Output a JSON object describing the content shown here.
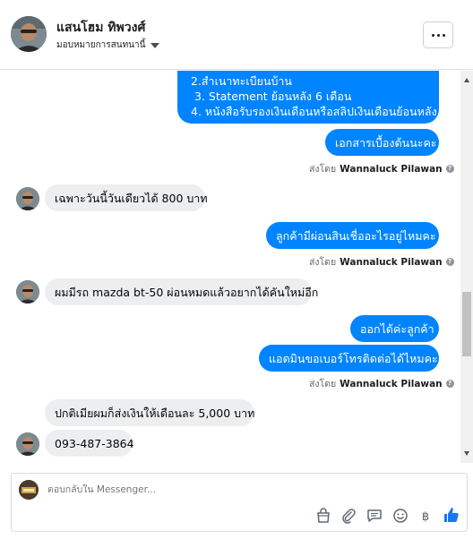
{
  "header": {
    "contact_name": "แสนโฮม ทิพวงศ์",
    "assign_label": "มอบหมายการสนทนานี้"
  },
  "thread": {
    "top_outgoing": {
      "lines": [
        "2.สำเนาทะเบียนบ้าน",
        "3. Statement ย้อนหลัง 6 เดือน",
        "4. หนังสือรับรองเงินเดือนหรือสลิปเงินเดือนย้อนหลัง"
      ]
    },
    "outgoing_1": "เอกสารเบื้องต้นนะคะ",
    "sent_by_prefix": "ส่งโดย",
    "agent_name": "Wannaluck Pilawan",
    "incoming_1": "เฉพาะวันนี้วันเดียวได้ 800 บาท",
    "outgoing_2": "ลูกค้ามีผ่อนสินเชื่ออะไรอยู่ไหมคะ",
    "incoming_2": "ผมมีรถ mazda bt-50 ผ่อนหมดแล้วอยากได้คันใหม่อีก",
    "outgoing_3a": "ออกได้ค่ะลูกค้า",
    "outgoing_3b": "แอดมินขอเบอร์โทรติดต่อได้ไหมคะ",
    "incoming_3a": "ปกติเมียผมก็ส่งเงินให้เดือนละ 5,000 บาท",
    "incoming_3b": "093-487-3864"
  },
  "composer": {
    "placeholder": "ตอบกลับใน Messenger...",
    "tools": [
      "shopping-bag-icon",
      "attachment-icon",
      "saved-reply-icon",
      "emoji-icon",
      "payment-icon",
      "like-icon"
    ]
  },
  "colors": {
    "outgoing_bubble": "#0084ff",
    "incoming_bubble": "#eceeef",
    "like_icon": "#1877f2"
  }
}
